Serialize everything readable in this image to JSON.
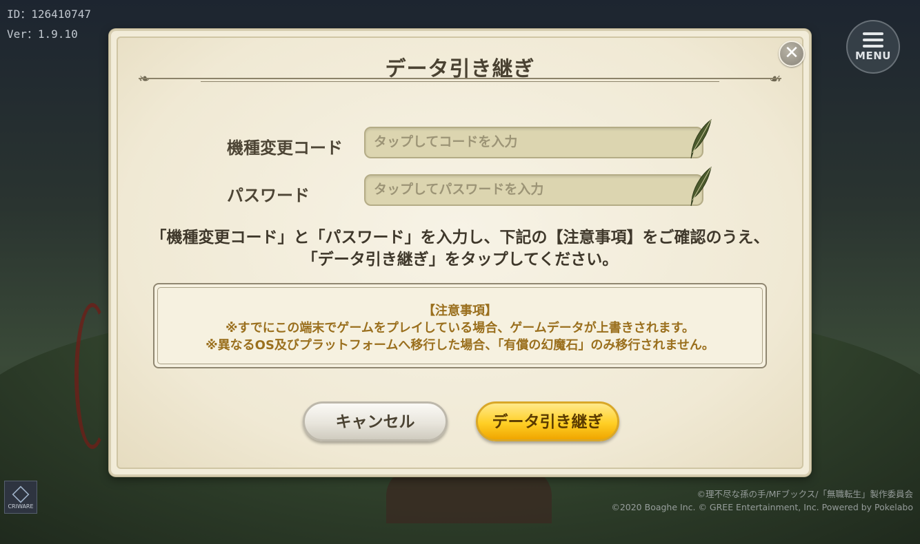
{
  "hud": {
    "id": "ID：126410747",
    "version": "Ver：1.9.10"
  },
  "menu": {
    "label": "MENU"
  },
  "dialog": {
    "title": "データ引き継ぎ",
    "fields": [
      {
        "label": "機種変更コード",
        "placeholder": "タップしてコードを入力",
        "value": ""
      },
      {
        "label": "パスワード",
        "placeholder": "タップしてパスワードを入力",
        "value": ""
      }
    ],
    "instruction_line1": "「機種変更コード」と「パスワード」を入力し、下記の【注意事項】をご確認のうえ、",
    "instruction_line2": "「データ引き継ぎ」をタップしてください。",
    "notice": {
      "title": "【注意事項】",
      "line1": "※すでにこの端末でゲームをプレイしている場合、ゲームデータが上書きされます。",
      "line2": "※異なるOS及びプラットフォームへ移行した場合、「有償の幻魔石」のみ移行されません。"
    },
    "cancel_label": "キャンセル",
    "confirm_label": "データ引き継ぎ"
  },
  "criware_label": "CRIWARE",
  "copyright_line1": "©理不尽な孫の手/MFブックス/「無職転生」製作委員会",
  "copyright_line2": "©2020 Boaghe Inc. © GREE Entertainment, Inc. Powered by Pokelabo",
  "colors": {
    "notice_text": "#9a6f1d",
    "confirm_button": "#ffcf25"
  }
}
